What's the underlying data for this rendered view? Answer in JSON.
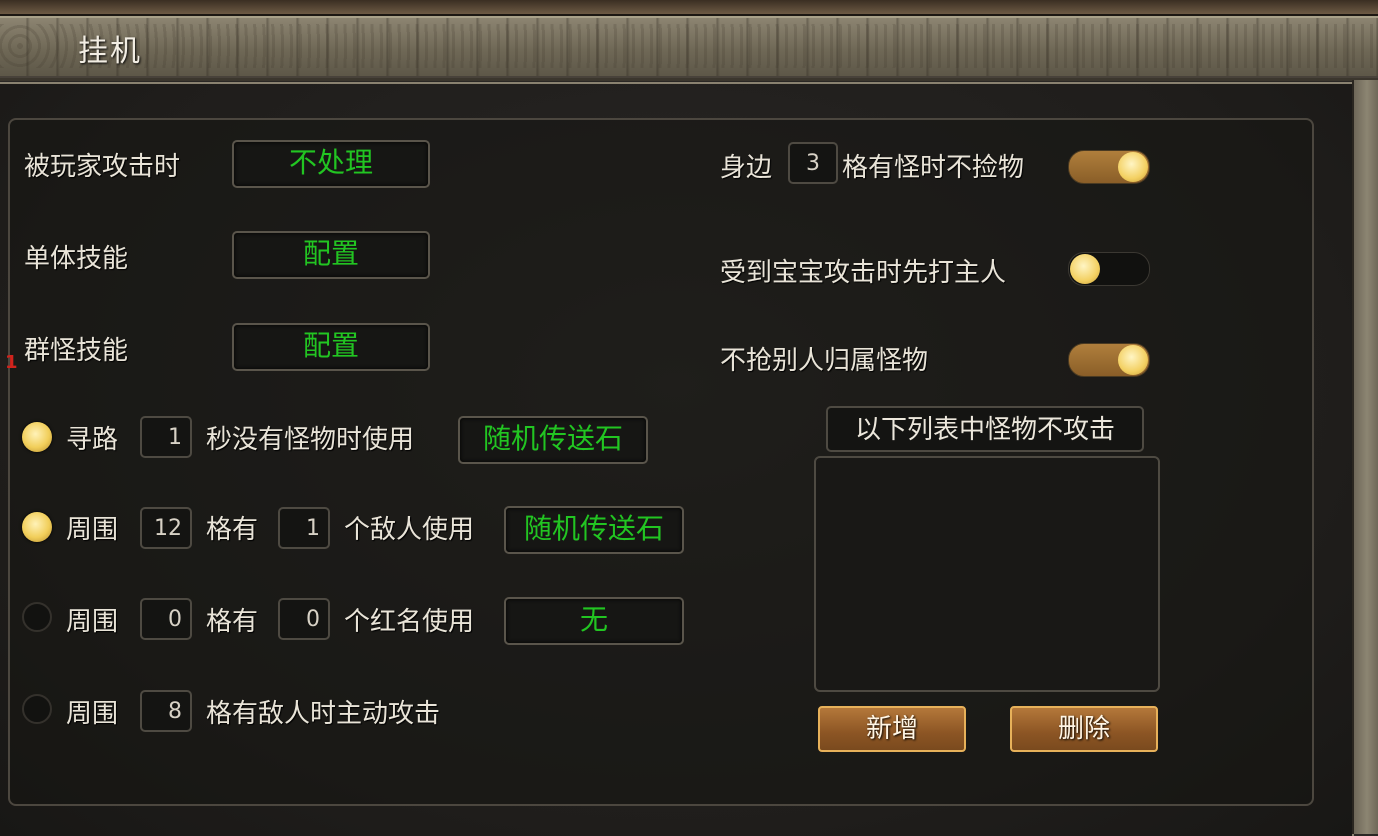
{
  "title": "挂机",
  "red_mark": "1",
  "left": {
    "player_attack": {
      "label": "被玩家攻击时",
      "value": "不处理"
    },
    "single_skill": {
      "label": "单体技能",
      "value": "配置"
    },
    "group_skill": {
      "label": "群怪技能",
      "value": "配置"
    },
    "row_pathfind": {
      "radio_on": true,
      "label1": "寻路",
      "num1": "1",
      "label2": "秒没有怪物时使用",
      "item": "随机传送石"
    },
    "row_enemy": {
      "radio_on": true,
      "label1": "周围",
      "num1": "12",
      "label2": "格有",
      "num2": "1",
      "label3": "个敌人使用",
      "item": "随机传送石"
    },
    "row_redname": {
      "radio_on": false,
      "label1": "周围",
      "num1": "0",
      "label2": "格有",
      "num2": "0",
      "label3": "个红名使用",
      "item": "无"
    },
    "row_attack": {
      "radio_on": false,
      "label1": "周围",
      "num1": "8",
      "label2": "格有敌人时主动攻击"
    }
  },
  "right": {
    "nopick": {
      "label1": "身边",
      "num": "3",
      "label2": "格有怪时不捡物",
      "toggle_on": true
    },
    "pet_attack": {
      "label": "受到宝宝攻击时先打主人",
      "toggle_on": false
    },
    "no_steal": {
      "label": "不抢别人归属怪物",
      "toggle_on": true
    },
    "list_header": "以下列表中怪物不攻击",
    "add_button": "新增",
    "delete_button": "删除"
  },
  "colors": {
    "accent_green": "#22c522",
    "toggle_on": "#a0702f",
    "knob": "#f3d062"
  }
}
